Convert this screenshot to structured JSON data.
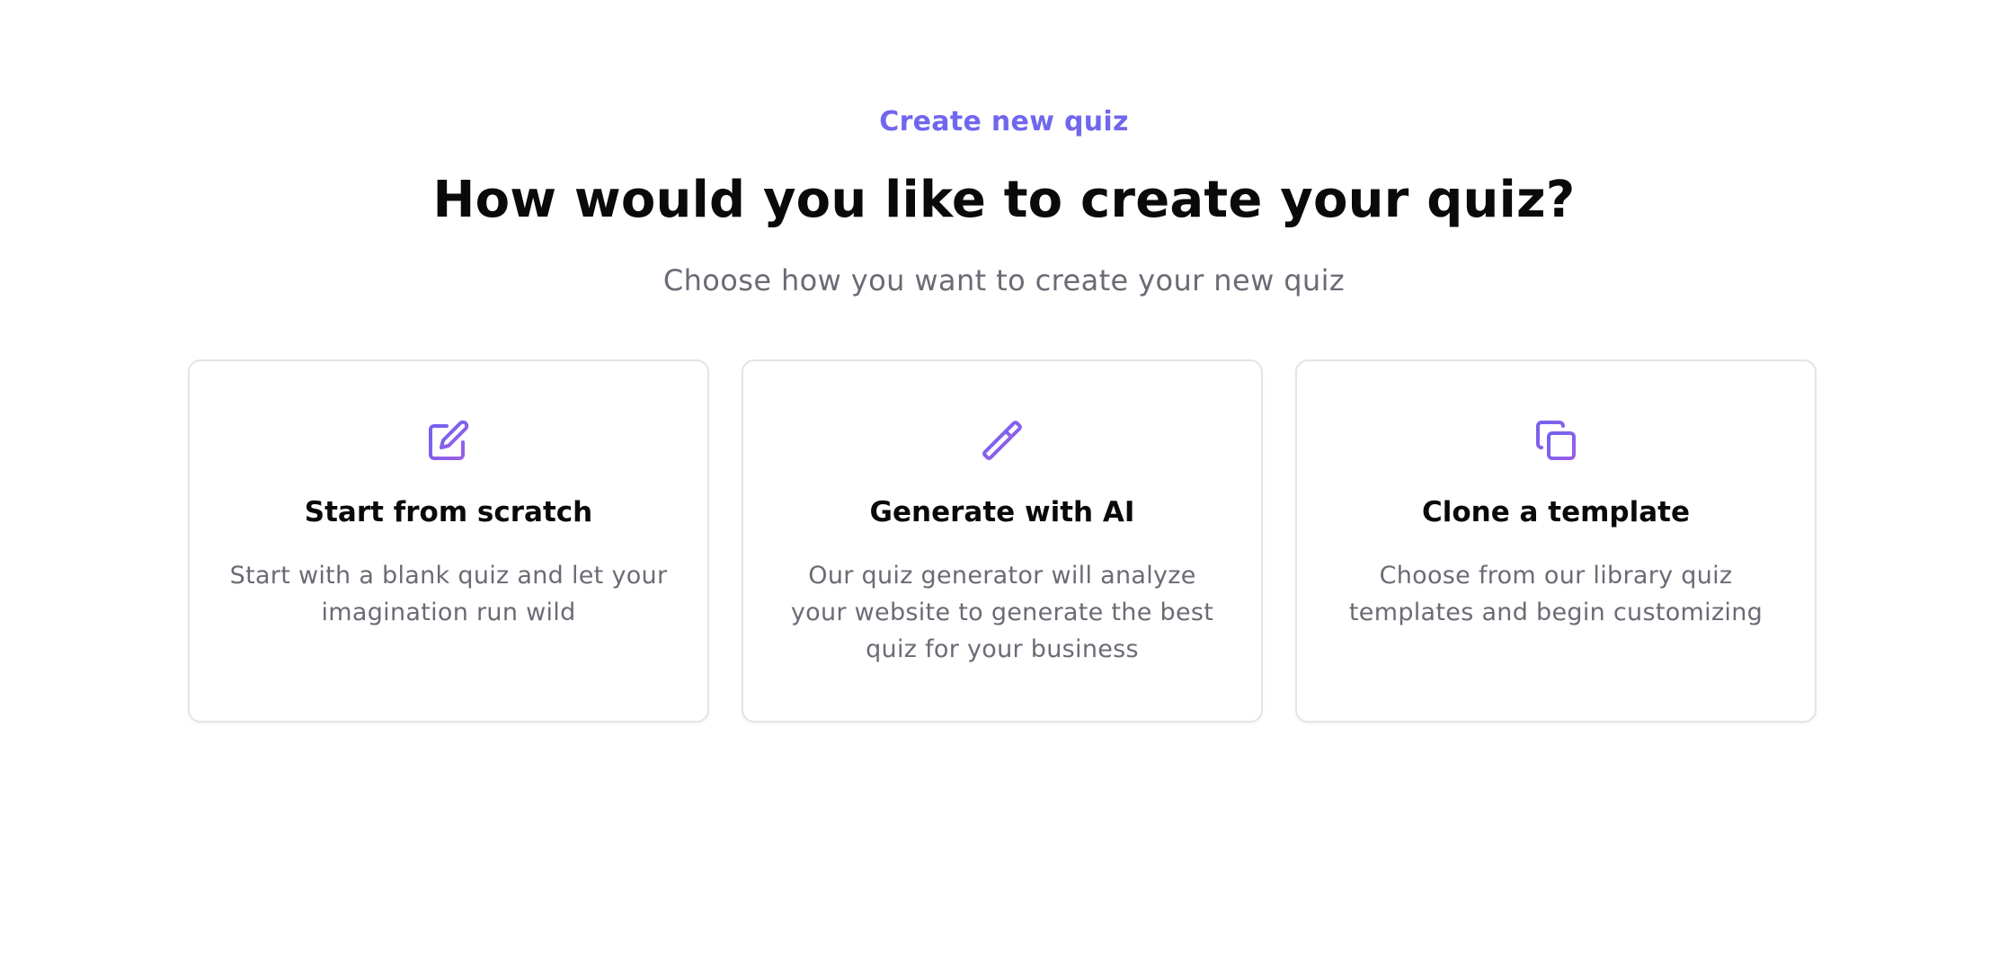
{
  "header": {
    "eyebrow": "Create new quiz",
    "title": "How would you like to create your quiz?",
    "subtitle": "Choose how you want to create your new quiz"
  },
  "colors": {
    "accent": "#7167ee",
    "icon_gradient_start": "#6f63f0",
    "icon_gradient_end": "#9b5ee8",
    "heading": "#0a0a0a",
    "muted_text": "#6b6b75",
    "card_border": "#e4e4e7"
  },
  "options": [
    {
      "icon": "pencil-square-icon",
      "title": "Start from scratch",
      "description": "Start with a blank quiz and let your imagination run wild"
    },
    {
      "icon": "magic-wand-icon",
      "title": "Generate with AI",
      "description": "Our quiz generator will analyze your website to generate the best quiz for your business"
    },
    {
      "icon": "copy-icon",
      "title": "Clone a template",
      "description": "Choose from our library quiz templates and begin customizing"
    }
  ]
}
